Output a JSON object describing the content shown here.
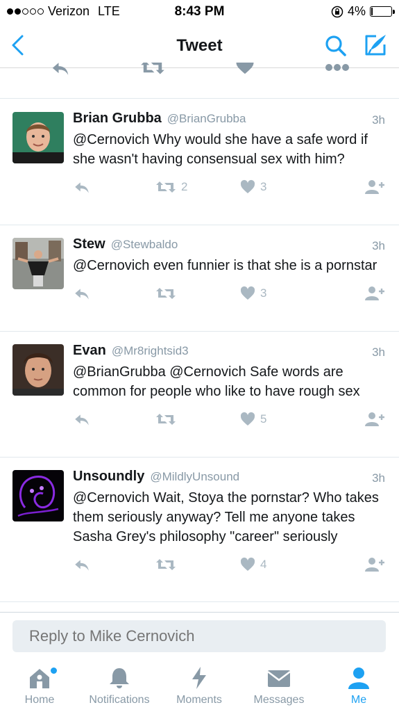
{
  "status_bar": {
    "carrier": "Verizon",
    "network": "LTE",
    "time": "8:43 PM",
    "battery_text": "4%",
    "battery_level": 0.04,
    "signal_bars_filled": 2,
    "signal_bars_total": 5
  },
  "nav": {
    "title": "Tweet",
    "back_icon": "chevron-left-icon",
    "search_icon": "search-icon",
    "compose_icon": "compose-icon"
  },
  "colors": {
    "accent": "#1da1f2",
    "text": "#14171a",
    "muted": "#8899a6",
    "action_gray": "#aab8c2"
  },
  "tweets": [
    {
      "name": "Brian Grubba",
      "handle": "@BrianGrubba",
      "time": "3h",
      "text": "@Cernovich Why would she have a safe word if she wasn't having consensual sex with him?",
      "retweets": "2",
      "likes": "3"
    },
    {
      "name": "Stew",
      "handle": "@Stewbaldo",
      "time": "3h",
      "text": "@Cernovich even funnier is that she is a pornstar",
      "retweets": "",
      "likes": "3"
    },
    {
      "name": "Evan",
      "handle": "@Mr8rightsid3",
      "time": "3h",
      "text": "@BrianGrubba @Cernovich Safe words are common for people who like to have rough sex",
      "retweets": "",
      "likes": "5"
    },
    {
      "name": "Unsoundly",
      "handle": "@MildlyUnsound",
      "time": "3h",
      "text": "@Cernovich Wait, Stoya the pornstar? Who takes them seriously anyway? Tell me anyone takes Sasha Grey's philosophy \"career\" seriously",
      "retweets": "",
      "likes": "4"
    }
  ],
  "reply": {
    "placeholder": "Reply to Mike Cernovich"
  },
  "tabs": [
    {
      "label": "Home",
      "icon": "home-icon",
      "active": false,
      "has_dot": true
    },
    {
      "label": "Notifications",
      "icon": "bell-icon",
      "active": false,
      "has_dot": false
    },
    {
      "label": "Moments",
      "icon": "lightning-icon",
      "active": false,
      "has_dot": false
    },
    {
      "label": "Messages",
      "icon": "envelope-icon",
      "active": false,
      "has_dot": false
    },
    {
      "label": "Me",
      "icon": "person-icon",
      "active": true,
      "has_dot": false
    }
  ]
}
